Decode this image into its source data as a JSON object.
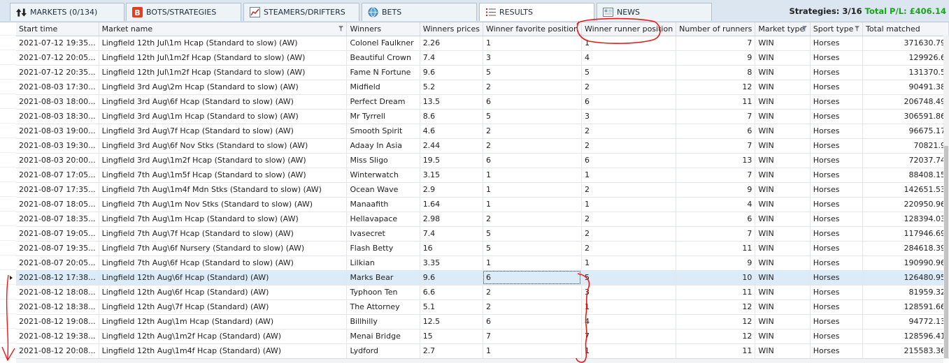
{
  "tabs": [
    {
      "label": "MARKETS (0/134)",
      "icon": "arrows-icon"
    },
    {
      "label": "BOTS/STRATEGIES",
      "icon": "bot-icon"
    },
    {
      "label": "STEAMERS/DRIFTERS",
      "icon": "chart-icon"
    },
    {
      "label": "BETS",
      "icon": "globe-icon"
    },
    {
      "label": "RESULTS",
      "icon": "list-icon"
    },
    {
      "label": "NEWS",
      "icon": "news-icon"
    }
  ],
  "summary": {
    "strategies": "Strategies: 3/16",
    "total_pl": "Total P/L: £406.14"
  },
  "columns": [
    "Start time",
    "Market name",
    "Winners",
    "Winners prices",
    "Winner favorite position",
    "Winner runner position",
    "Number of runners",
    "Market type",
    "Sport type",
    "Total matched"
  ],
  "rows": [
    [
      "2021-07-12 19:35...",
      "Lingfield 12th Jul\\1m Hcap (Standard to slow) (AW)",
      "Colonel Faulkner",
      "2.26",
      "1",
      "1",
      "7",
      "WIN",
      "Horses",
      "371630.79"
    ],
    [
      "2021-07-12 20:05...",
      "Lingfield 12th Jul\\1m2f Hcap (Standard to slow) (AW)",
      "Beautiful Crown",
      "7.4",
      "3",
      "4",
      "9",
      "WIN",
      "Horses",
      "129926.6"
    ],
    [
      "2021-07-12 20:35...",
      "Lingfield 12th Jul\\1m2f Hcap (Standard to slow) (AW)",
      "Fame N Fortune",
      "9.6",
      "5",
      "5",
      "8",
      "WIN",
      "Horses",
      "131370.5"
    ],
    [
      "2021-08-03 17:30...",
      "Lingfield 3rd Aug\\2m Hcap (Standard to slow) (AW)",
      "Midfield",
      "5.2",
      "2",
      "2",
      "12",
      "WIN",
      "Horses",
      "90491.38"
    ],
    [
      "2021-08-03 18:00...",
      "Lingfield 3rd Aug\\6f Hcap (Standard to slow) (AW)",
      "Perfect Dream",
      "13.5",
      "6",
      "6",
      "11",
      "WIN",
      "Horses",
      "206748.49"
    ],
    [
      "2021-08-03 18:30...",
      "Lingfield 3rd Aug\\1m Hcap (Standard to slow) (AW)",
      "Mr Tyrrell",
      "8.6",
      "5",
      "3",
      "7",
      "WIN",
      "Horses",
      "306591.86"
    ],
    [
      "2021-08-03 19:00...",
      "Lingfield 3rd Aug\\7f Hcap (Standard to slow) (AW)",
      "Smooth Spirit",
      "4.6",
      "2",
      "2",
      "6",
      "WIN",
      "Horses",
      "96675.17"
    ],
    [
      "2021-08-03 19:30...",
      "Lingfield 3rd Aug\\6f Nov Stks (Standard to slow) (AW)",
      "Adaay In Asia",
      "2.44",
      "2",
      "2",
      "7",
      "WIN",
      "Horses",
      "70821.9"
    ],
    [
      "2021-08-03 20:00...",
      "Lingfield 3rd Aug\\1m2f Hcap (Standard to slow) (AW)",
      "Miss Sligo",
      "19.5",
      "6",
      "6",
      "13",
      "WIN",
      "Horses",
      "72037.74"
    ],
    [
      "2021-08-07 17:05...",
      "Lingfield 7th Aug\\1m5f Hcap (Standard to slow) (AW)",
      "Winterwatch",
      "3.15",
      "1",
      "1",
      "7",
      "WIN",
      "Horses",
      "88408.15"
    ],
    [
      "2021-08-07 17:35...",
      "Lingfield 7th Aug\\1m4f Mdn Stks (Standard to slow) (AW)",
      "Ocean Wave",
      "2.9",
      "1",
      "2",
      "9",
      "WIN",
      "Horses",
      "142651.53"
    ],
    [
      "2021-08-07 18:05...",
      "Lingfield 7th Aug\\1m Nov Stks (Standard to slow) (AW)",
      "Manaafith",
      "1.64",
      "1",
      "1",
      "4",
      "WIN",
      "Horses",
      "220950.96"
    ],
    [
      "2021-08-07 18:35...",
      "Lingfield 7th Aug\\1m Hcap (Standard to slow) (AW)",
      "Hellavapace",
      "2.98",
      "2",
      "2",
      "6",
      "WIN",
      "Horses",
      "128394.03"
    ],
    [
      "2021-08-07 19:05...",
      "Lingfield 7th Aug\\7f Hcap (Standard to slow) (AW)",
      "Ivasecret",
      "7.4",
      "5",
      "2",
      "7",
      "WIN",
      "Horses",
      "117946.69"
    ],
    [
      "2021-08-07 19:35...",
      "Lingfield 7th Aug\\6f Nursery (Standard to slow) (AW)",
      "Flash Betty",
      "16",
      "5",
      "2",
      "11",
      "WIN",
      "Horses",
      "284618.39"
    ],
    [
      "2021-08-07 20:05...",
      "Lingfield 7th Aug\\6f Hcap (Standard to slow) (AW)",
      "Lilkian",
      "3.35",
      "1",
      "1",
      "9",
      "WIN",
      "Horses",
      "190990.96"
    ],
    [
      "2021-08-12 17:38...",
      "Lingfield 12th Aug\\6f Hcap (Standard) (AW)",
      "Marks Bear",
      "9.6",
      "6",
      "5",
      "10",
      "WIN",
      "Horses",
      "126480.95"
    ],
    [
      "2021-08-12 18:08...",
      "Lingfield 12th Aug\\6f Hcap (Standard) (AW)",
      "Typhoon Ten",
      "6.6",
      "2",
      "3",
      "11",
      "WIN",
      "Horses",
      "81959.32"
    ],
    [
      "2021-08-12 18:38...",
      "Lingfield 12th Aug\\7f Hcap (Standard) (AW)",
      "The Attorney",
      "5.1",
      "2",
      "1",
      "12",
      "WIN",
      "Horses",
      "128591.66"
    ],
    [
      "2021-08-12 19:08...",
      "Lingfield 12th Aug\\1m Hcap (Standard) (AW)",
      "Billhilly",
      "12.5",
      "6",
      "4",
      "12",
      "WIN",
      "Horses",
      "94772.13"
    ],
    [
      "2021-08-12 19:38...",
      "Lingfield 12th Aug\\1m2f Hcap (Standard) (AW)",
      "Menai Bridge",
      "15",
      "7",
      "7",
      "12",
      "WIN",
      "Horses",
      "128596.41"
    ],
    [
      "2021-08-12 20:08...",
      "Lingfield 12th Aug\\1m4f Hcap (Standard) (AW)",
      "Lydford",
      "2.7",
      "1",
      "1",
      "11",
      "WIN",
      "Horses",
      "215583.36"
    ]
  ],
  "selected_row": 16,
  "colors": {
    "accent_red": "#e31b1b",
    "profit_green": "#1aa31a",
    "selection": "#dcebf8"
  }
}
